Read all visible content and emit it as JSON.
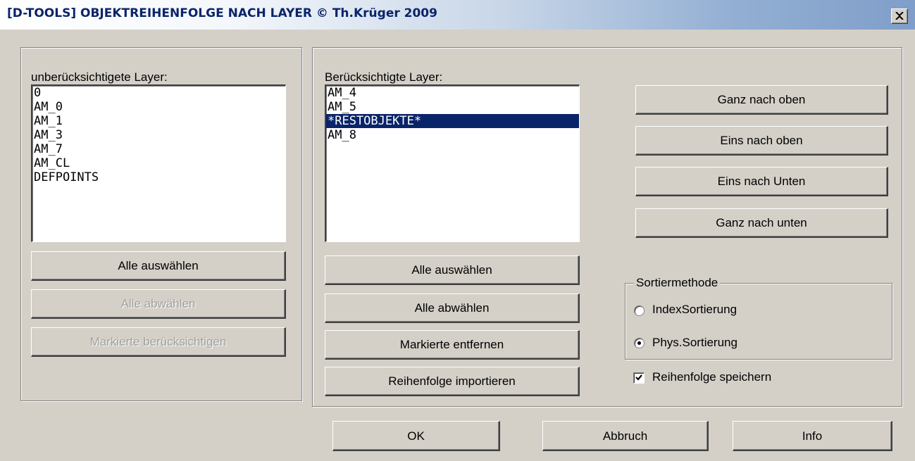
{
  "window": {
    "title": "[D-TOOLS] OBJEKTREIHENFOLGE NACH LAYER © Th.Krüger 2009"
  },
  "left_panel": {
    "label": "unberücksichtigete Layer:",
    "items": [
      "0",
      "AM_0",
      "AM_1",
      "AM_3",
      "AM_7",
      "AM_CL",
      "DEFPOINTS"
    ],
    "buttons": {
      "select_all": "Alle auswählen",
      "deselect_all": "Alle abwählen",
      "consider_marked": "Markierte berücksichtigen"
    }
  },
  "middle_panel": {
    "label": "Berücksichtigte Layer:",
    "items": [
      "AM_4",
      "AM_5",
      "*RESTOBJEKTE*",
      "AM_8"
    ],
    "selected_item": "*RESTOBJEKTE*",
    "buttons": {
      "select_all": "Alle auswählen",
      "deselect_all": "Alle abwählen",
      "remove_marked": "Markierte entfernen",
      "import_order": "Reihenfolge importieren"
    }
  },
  "order_buttons": {
    "to_top": "Ganz nach oben",
    "up_one": "Eins nach oben",
    "down_one": "Eins nach Unten",
    "to_bottom": "Ganz nach unten"
  },
  "sort_method": {
    "legend": "Sortiermethode",
    "options": [
      "IndexSortierung",
      "Phys.Sortierung"
    ],
    "selected": "Phys.Sortierung"
  },
  "save_order": {
    "label": "Reihenfolge speichern",
    "checked": true
  },
  "footer": {
    "ok": "OK",
    "cancel": "Abbruch",
    "info": "Info"
  }
}
